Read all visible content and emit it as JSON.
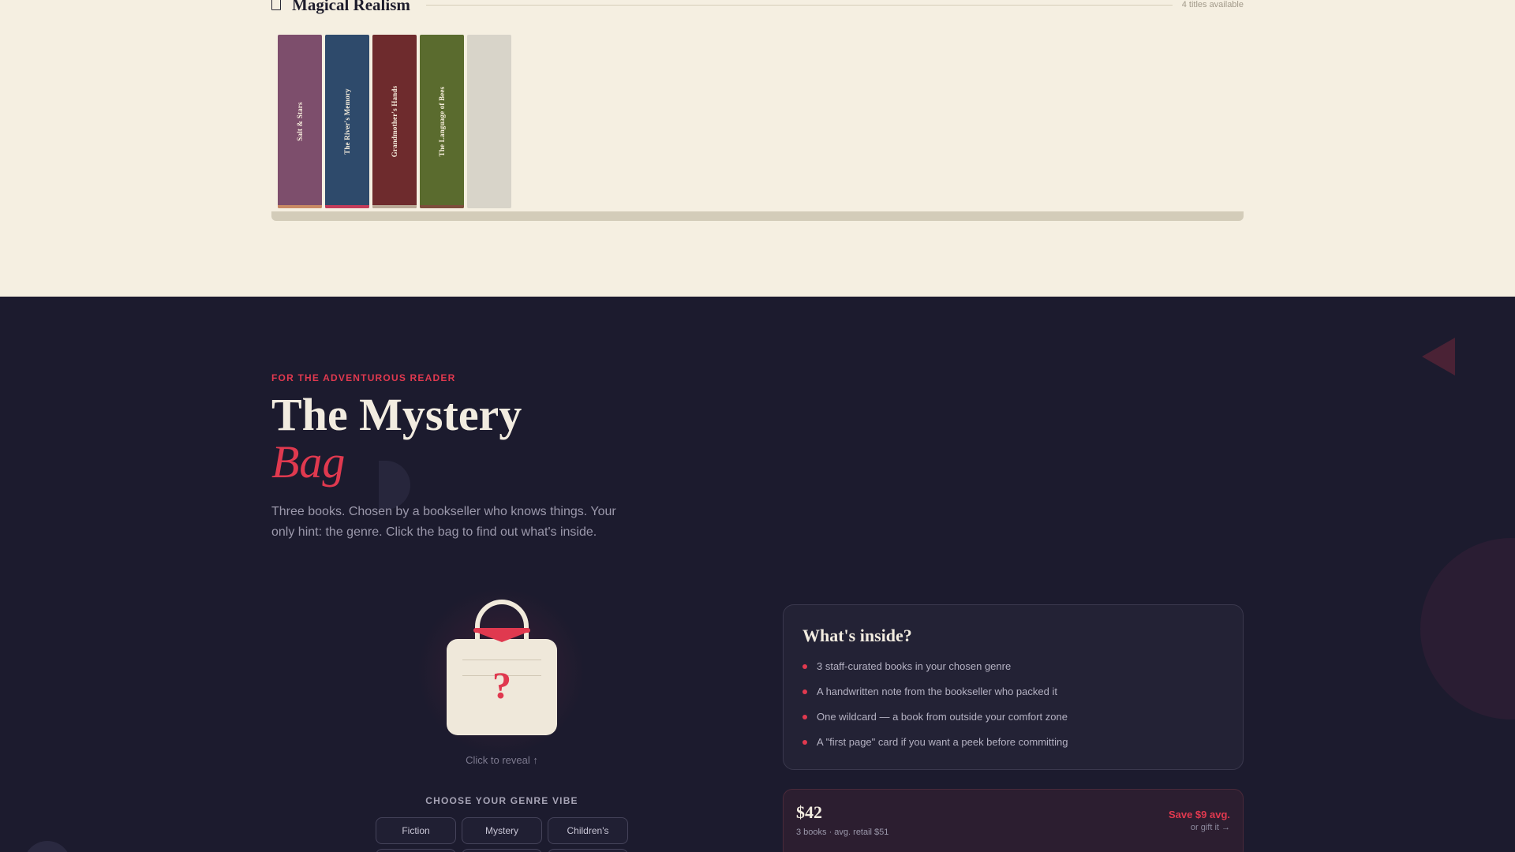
{
  "shelf": {
    "title": "Magical Realism",
    "count": "4 titles available",
    "books": [
      {
        "title": "Salt & Stars",
        "color": "#7d4e6c",
        "base": "#c98a64"
      },
      {
        "title": "The River's Memory",
        "color": "#2e4a6b",
        "base": "#c43c5a"
      },
      {
        "title": "Grandmother's Hands",
        "color": "#6e2b2d",
        "base": "#b9a996"
      },
      {
        "title": "The Language of Bees",
        "color": "#5a6b2e",
        "base": "#7d4e3c"
      }
    ],
    "placeholder_color": "#d8d4c9"
  },
  "mystery": {
    "eyebrow": "FOR THE ADVENTUROUS READER",
    "title": "The Mystery",
    "title_accent": "Bag",
    "subtitle": "Three books. Chosen by a bookseller who knows things. Your only hint: the genre. Click the bag to find out what's inside.",
    "bag_symbol": "?",
    "reveal_hint": "Click to reveal ↑",
    "genre_label": "CHOOSE YOUR GENRE VIBE",
    "genres": [
      "Fiction",
      "Mystery",
      "Children's"
    ]
  },
  "inside": {
    "title": "What's inside?",
    "items": [
      "3 staff-curated books in your chosen genre",
      "A handwritten note from the bookseller who packed it",
      "One wildcard — a book from outside your comfort zone",
      "A \"first page\" card if you want a peek before committing"
    ]
  },
  "pricing": {
    "price": "$42",
    "detail": "3 books · avg. retail $51",
    "save": "Save $9 avg.",
    "gift": "or gift it →"
  },
  "colors": {
    "accent": "#e0394f",
    "cream": "#f5efe1",
    "dark": "#1c1b2e"
  }
}
